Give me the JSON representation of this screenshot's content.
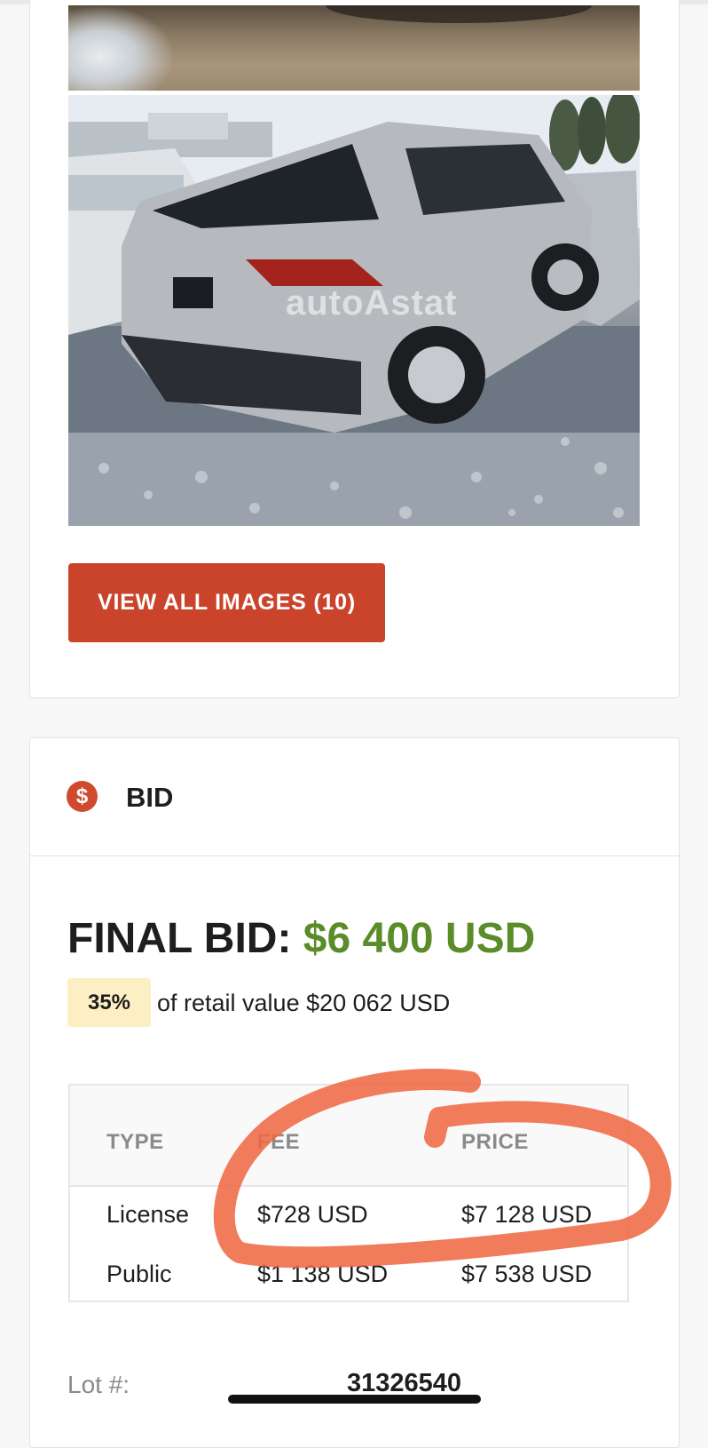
{
  "gallery": {
    "watermark_text": "autoAstat",
    "view_all_button": "VIEW ALL IMAGES (10)"
  },
  "bid": {
    "section_title": "BID",
    "section_icon": "dollar-circle-icon",
    "final_bid_label": "FINAL BID:",
    "final_bid_amount": "$6 400 USD",
    "retail_percent": "35%",
    "retail_text": "of retail value $20 062 USD",
    "table": {
      "headers": [
        "TYPE",
        "FEE",
        "PRICE"
      ],
      "rows": [
        [
          "License",
          "$728 USD",
          "$7 128 USD"
        ],
        [
          "Public",
          "$1 138 USD",
          "$7 538 USD"
        ]
      ]
    },
    "lot_label": "Lot #:",
    "lot_value": "31326540"
  },
  "colors": {
    "accent_red": "#c9442b",
    "bid_green": "#5b8c2a",
    "badge_yellow": "#fdefc4",
    "annotation_orange": "#ee6a45"
  }
}
